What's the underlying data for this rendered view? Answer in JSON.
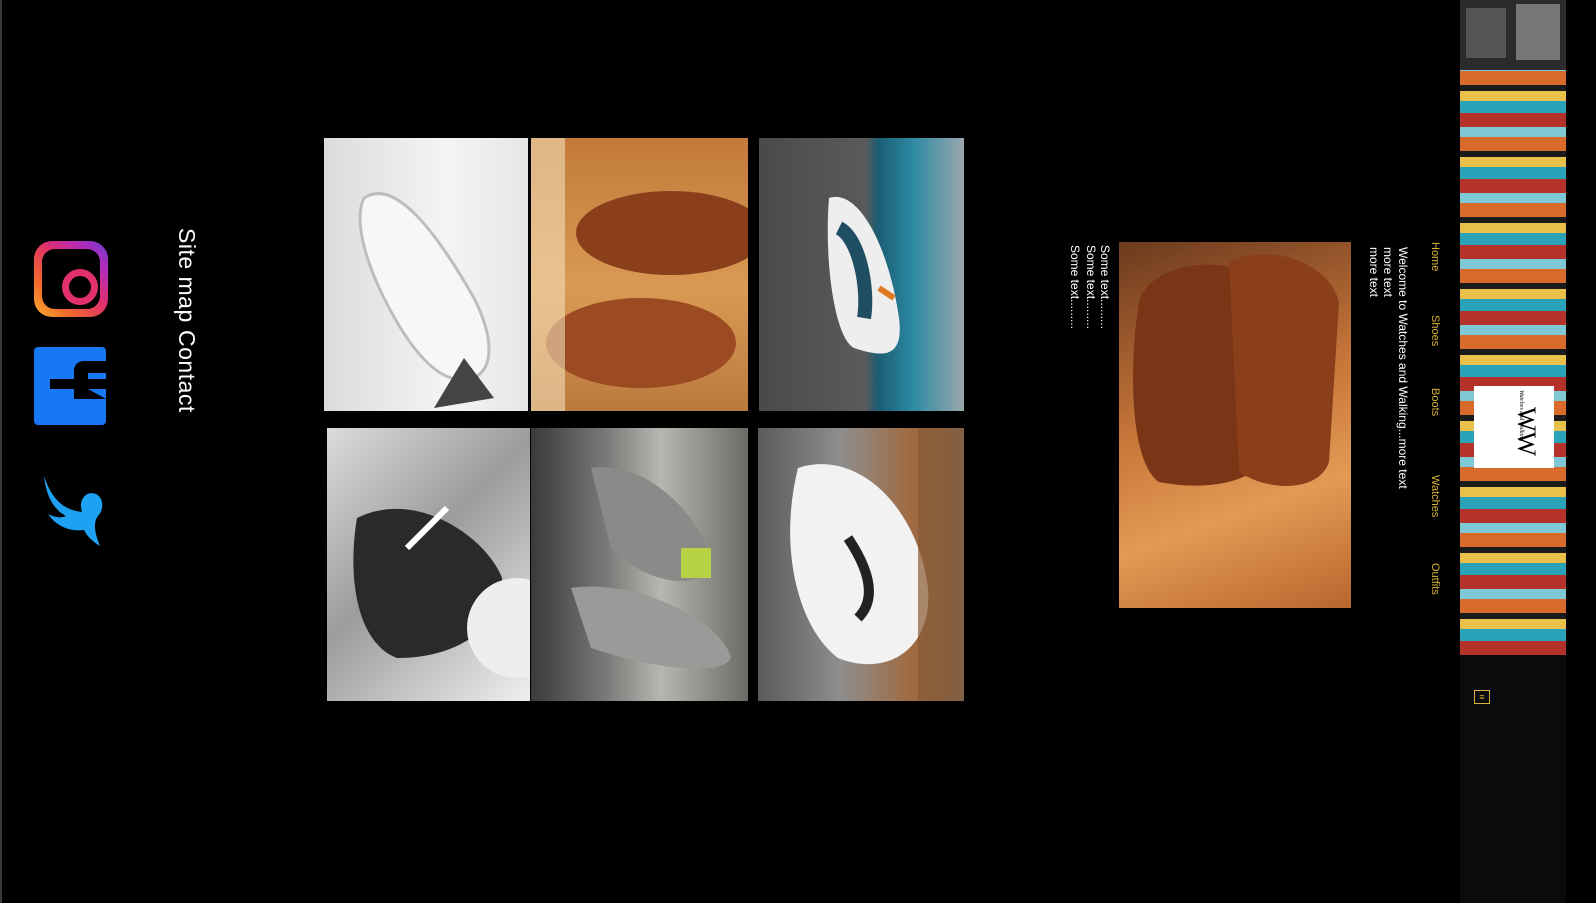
{
  "footer": {
    "site_map": "Site map",
    "contact": "Contact"
  },
  "social": [
    {
      "icon": "instagram-icon",
      "color": "#e1306c"
    },
    {
      "icon": "facebook-icon",
      "color": "#1877f2"
    },
    {
      "icon": "twitter-icon",
      "color": "#1da1f2"
    }
  ],
  "gallery": [
    {
      "subject": "white sneaker"
    },
    {
      "subject": "brown leather oxford shoes"
    },
    {
      "subject": "running sneaker"
    },
    {
      "subject": "black sneaker"
    },
    {
      "subject": "grey knit sneakers"
    },
    {
      "subject": "white sneaker on foot"
    }
  ],
  "intro": {
    "welcome": "Welcome to Watches and Walking...more text",
    "more_1": "more text",
    "more_2": "more text",
    "some_1": "Some text.........",
    "some_2": "Some text.........",
    "some_3": "Some text........."
  },
  "nav": {
    "items": [
      "Home",
      "Shoes",
      "Boots",
      "Watches",
      "Outfits"
    ],
    "color": "#d8b43a"
  },
  "brand": {
    "logo_text": "WW",
    "logo_tagline": "Watches and Walking"
  }
}
